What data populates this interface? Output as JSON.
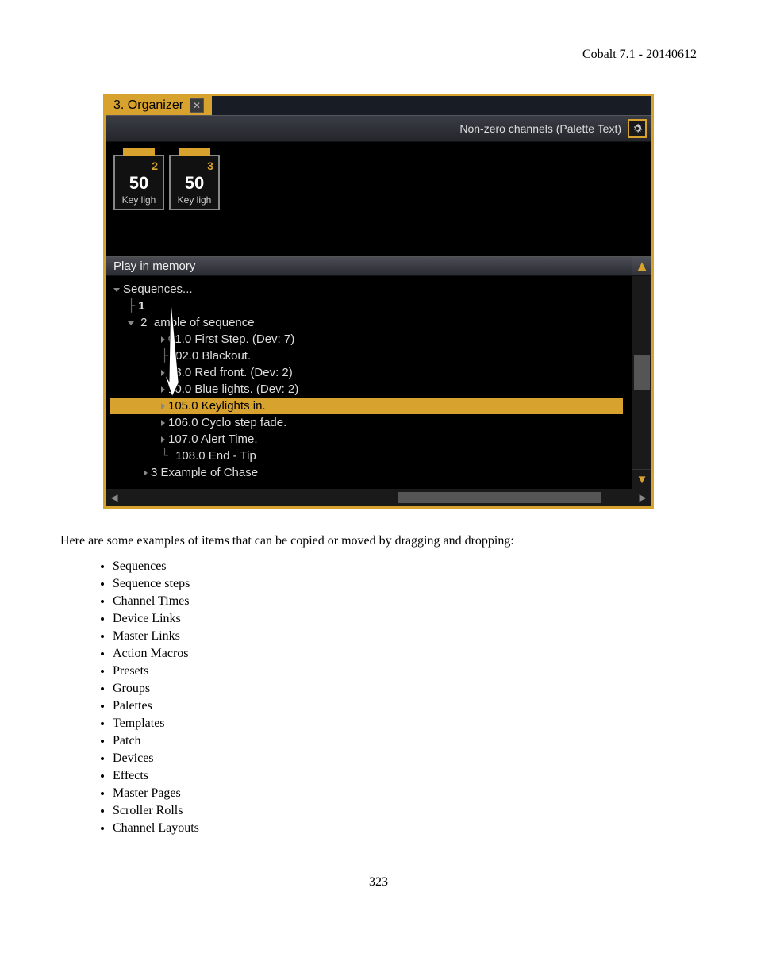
{
  "header": {
    "title": "Cobalt 7.1 - 20140612"
  },
  "screenshot": {
    "tab": {
      "label": "3. Organizer"
    },
    "toolbar": {
      "mode": "Non-zero channels (Palette Text)"
    },
    "channels": [
      {
        "num": "2",
        "value": "50",
        "label": "Key ligh"
      },
      {
        "num": "3",
        "value": "50",
        "label": "Key ligh"
      }
    ],
    "section": "Play in memory",
    "tree": {
      "root": "Sequences...",
      "n1": "1",
      "n2_prefix": "2",
      "n2_suffix": "ample of sequence",
      "steps": [
        "01.0 First Step.  (Dev: 7)",
        "02.0 Blackout.",
        "3.0 Red front. (Dev: 2)",
        ".0 Blue lights. (Dev: 2)",
        "105.0 Keylights in.",
        "106.0 Cyclo step fade.",
        "107.0 Alert Time.",
        "108.0 End - Tip"
      ],
      "step_pre": [
        "1",
        "10"
      ],
      "n3": "3 Example of Chase"
    }
  },
  "body": {
    "intro": "Here are some examples of items that can be copied or moved by dragging and dropping:",
    "items": [
      "Sequences",
      "Sequence steps",
      "Channel Times",
      "Device Links",
      "Master Links",
      "Action Macros",
      "Presets",
      "Groups",
      "Palettes",
      "Templates",
      "Patch",
      "Devices",
      "Effects",
      "Master Pages",
      "Scroller Rolls",
      "Channel Layouts"
    ]
  },
  "page": "323"
}
